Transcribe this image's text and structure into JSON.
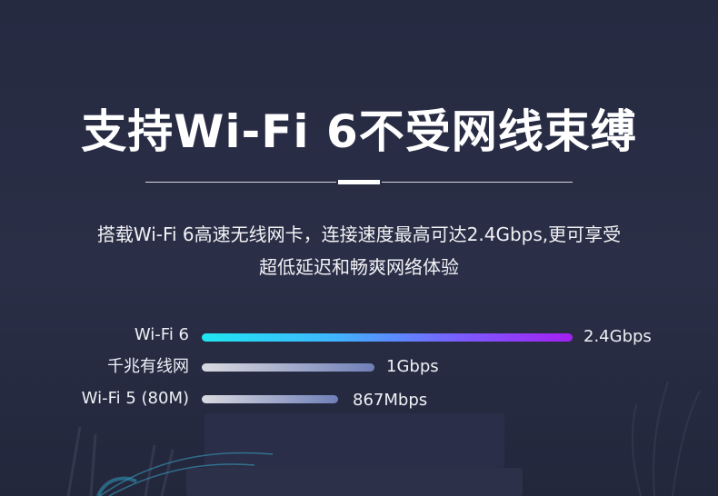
{
  "headline": "支持Wi-Fi 6不受网线束缚",
  "subtitle": {
    "line1": "搭载Wi-Fi 6高速无线网卡，连接速度最高可达2.4Gbps,更可享受",
    "line2": "超低延迟和畅爽网络体验"
  },
  "speed_comparison": [
    {
      "label": "Wi-Fi 6",
      "value": "2.4Gbps",
      "gbps": 2.4,
      "color_start": "#1fe6f0",
      "color_end": "#a41ff2"
    },
    {
      "label": "千兆有线网",
      "value": "1Gbps",
      "gbps": 1.0,
      "color_start": "#d9d9df",
      "color_end": "#6f7fb8"
    },
    {
      "label": "Wi-Fi 5 (80M)",
      "value": "867Mbps",
      "gbps": 0.867,
      "color_start": "#d9d9df",
      "color_end": "#6f7fb8"
    }
  ],
  "colors": {
    "background": "#262a41",
    "text": "#ffffff"
  }
}
